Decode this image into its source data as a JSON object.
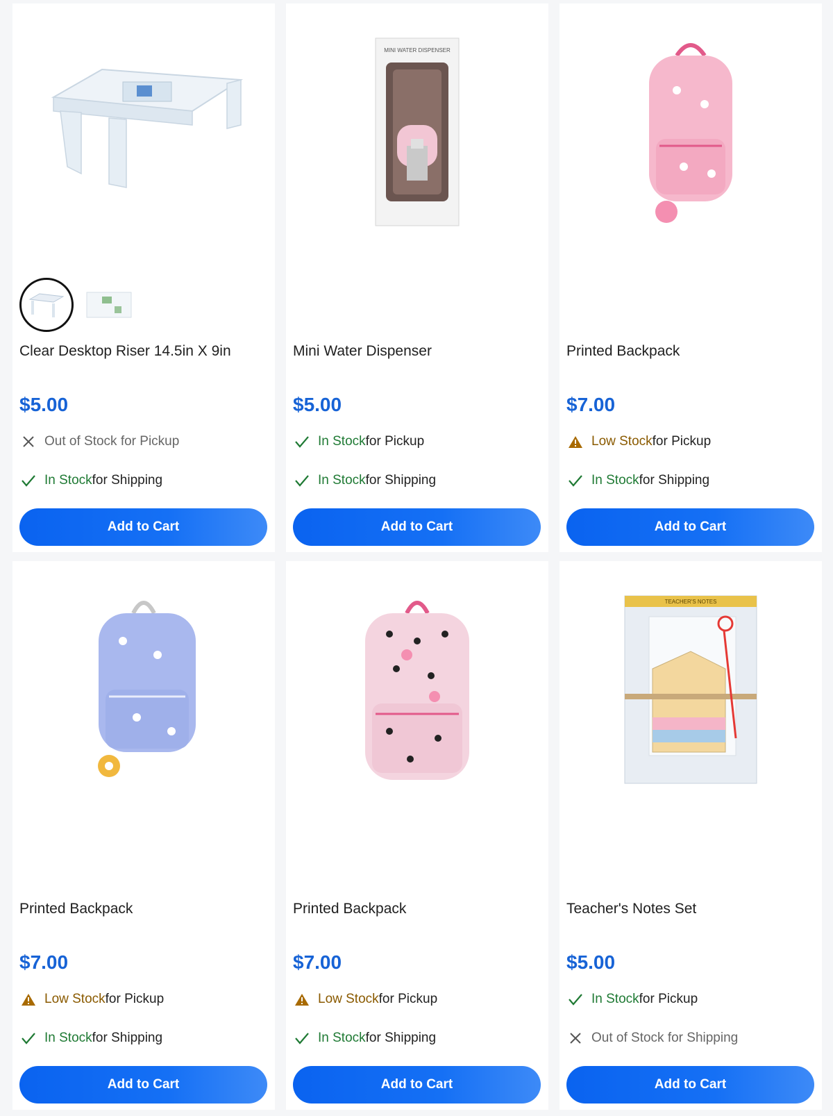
{
  "products": [
    {
      "title": "Clear Desktop Riser 14.5in X 9in",
      "price": "$5.00",
      "pickup": {
        "status": "Out of Stock for Pickup",
        "rest": ""
      },
      "shipping": {
        "status": "In Stock",
        "rest": " for Shipping"
      },
      "button": "Add to Cart",
      "image_icon": "desktop-riser-image"
    },
    {
      "title": "Mini Water Dispenser",
      "price": "$5.00",
      "pickup": {
        "status": "In Stock",
        "rest": " for Pickup"
      },
      "shipping": {
        "status": "In Stock",
        "rest": " for Shipping"
      },
      "button": "Add to Cart",
      "box_text": "MINI WATER DISPENSER",
      "image_icon": "water-dispenser-image"
    },
    {
      "title": "Printed Backpack",
      "price": "$7.00",
      "pickup": {
        "status": "Low Stock",
        "rest": " for Pickup"
      },
      "shipping": {
        "status": "In Stock",
        "rest": " for Shipping"
      },
      "button": "Add to Cart",
      "image_icon": "pink-backpack-image"
    },
    {
      "title": "Printed Backpack",
      "price": "$7.00",
      "pickup": {
        "status": "Low Stock",
        "rest": " for Pickup"
      },
      "shipping": {
        "status": "In Stock",
        "rest": " for Shipping"
      },
      "button": "Add to Cart",
      "image_icon": "blue-floral-backpack-image"
    },
    {
      "title": "Printed Backpack",
      "price": "$7.00",
      "pickup": {
        "status": "Low Stock",
        "rest": " for Pickup"
      },
      "shipping": {
        "status": "In Stock",
        "rest": " for Shipping"
      },
      "button": "Add to Cart",
      "image_icon": "leopard-backpack-image"
    },
    {
      "title": "Teacher's Notes Set",
      "price": "$5.00",
      "pickup": {
        "status": "In Stock",
        "rest": " for Pickup"
      },
      "shipping": {
        "status": "Out of Stock for Shipping",
        "rest": ""
      },
      "button": "Add to Cart",
      "pad_text": "TEACHER'S NOTES",
      "image_icon": "notes-set-image"
    }
  ],
  "colors": {
    "price": "#1763d6",
    "in_stock": "#1f7a34",
    "low_stock": "#8a5a00",
    "button": "#0a63f0"
  }
}
